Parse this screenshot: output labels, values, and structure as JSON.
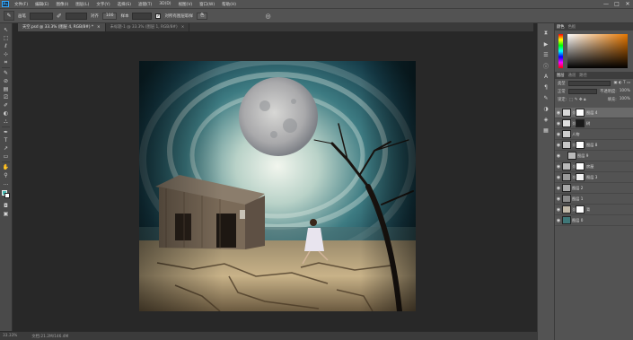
{
  "menubar": {
    "app_icon": "Ps",
    "items": [
      "文件(F)",
      "编辑(E)",
      "图像(I)",
      "图层(L)",
      "文字(Y)",
      "选择(S)",
      "滤镜(T)",
      "3D(D)",
      "视图(V)",
      "窗口(W)",
      "帮助(H)"
    ],
    "controls": [
      "—",
      "□",
      "✕"
    ]
  },
  "options_bar": {
    "brush_label": "画笔",
    "align_label": "对齐",
    "sample_label": "样本",
    "all_layers_value": "所有图层",
    "checkbox_label": "对所有图层取样",
    "checked": true,
    "button_label": "色",
    "icon_text": "100"
  },
  "tabs": [
    {
      "label": "天空.psd @ 33.3% (图层 4, RGB/8#) *",
      "active": true
    },
    {
      "label": "未标题-1 @ 33.3% (图层 1, RGB/8#)",
      "active": false
    }
  ],
  "tools": [
    "↖",
    "⬚",
    "ℓ",
    "⊹",
    "⌗",
    "✎",
    "⊘",
    "▤",
    "⎚",
    "✐",
    "◐",
    "⛬",
    "✒",
    "T",
    "↗",
    "▭",
    "✋",
    "⚲",
    "…"
  ],
  "status": {
    "zoom": "33.33%",
    "doc_size": "文档:21.2M/146.4M"
  },
  "panel": {
    "top_tabs": [
      "颜色",
      "色板"
    ],
    "layers_tabs": [
      "图层",
      "通道",
      "路径"
    ],
    "kind_label": "类型",
    "blend_mode": "正常",
    "opacity_label": "不透明度:",
    "opacity_value": "100%",
    "lock_label": "锁定:",
    "fill_label": "填充:",
    "fill_value": "100%"
  },
  "layers": [
    {
      "name": "图层 4",
      "selected": true,
      "thumb": "#d8d8d8",
      "mask": "#ffffff",
      "indent": false
    },
    {
      "name": "树",
      "selected": false,
      "thumb": "#e0e0e0",
      "mask": "#1a1a1a",
      "indent": false
    },
    {
      "name": "人物",
      "selected": false,
      "thumb": "#cfcfcf",
      "mask": null,
      "indent": false
    },
    {
      "name": "图层 8",
      "selected": false,
      "thumb": "#c8c8c8",
      "mask": "#ffffff",
      "indent": false
    },
    {
      "name": "图层 9",
      "selected": false,
      "thumb": "#bbbbbb",
      "mask": null,
      "indent": true
    },
    {
      "name": "房屋",
      "selected": false,
      "thumb": "#b8b8b8",
      "mask": "#ffffff",
      "indent": false
    },
    {
      "name": "图层 3",
      "selected": false,
      "thumb": "#9a9a9a",
      "mask": "#f0f0f0",
      "indent": false
    },
    {
      "name": "图层 2",
      "selected": false,
      "thumb": "#a8a8a8",
      "mask": null,
      "indent": false
    },
    {
      "name": "图层 1",
      "selected": false,
      "thumb": "#8a8a8a",
      "mask": null,
      "indent": false
    },
    {
      "name": "背",
      "selected": false,
      "thumb": "#c0b8a8",
      "mask": "#ffffff",
      "indent": false
    },
    {
      "name": "图层 0",
      "selected": false,
      "thumb": "#3f7778",
      "mask": null,
      "indent": false
    }
  ],
  "colors": {
    "ui_bg": "#535353",
    "canvas_bg": "#282828",
    "accent": "#31a8ff",
    "sky_teal": "#1e4b55",
    "ground": "#b8a07a"
  }
}
